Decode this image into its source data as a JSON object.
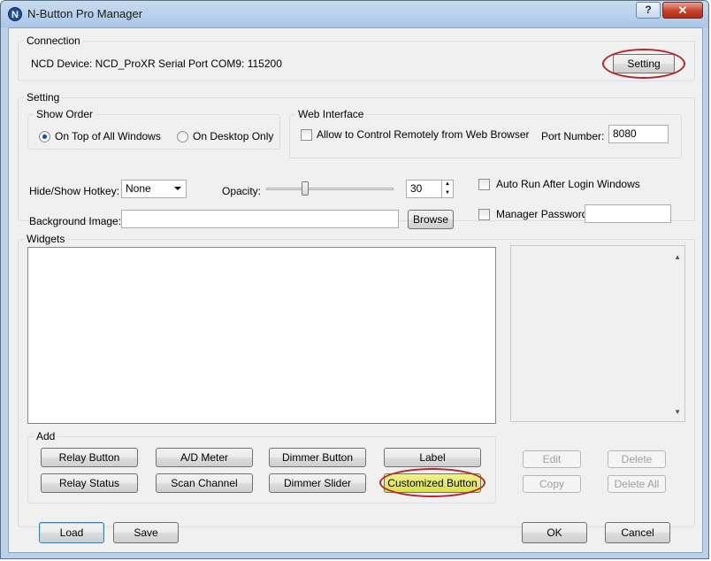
{
  "window": {
    "title": "N-Button Pro Manager",
    "app_icon_letter": "N",
    "help_label": "?",
    "close_label": "✕"
  },
  "connection": {
    "group_label": "Connection",
    "status_text": "NCD Device: NCD_ProXR  Serial Port  COM9: 115200",
    "setting_button": "Setting",
    "setting_highlighted": true
  },
  "setting": {
    "group_label": "Setting",
    "show_order": {
      "label": "Show Order",
      "options": [
        "On Top of All Windows",
        "On Desktop Only"
      ],
      "selected": "On Top of All Windows"
    },
    "web_interface": {
      "label": "Web Interface",
      "allow_remote_label": "Allow to Control Remotely from Web Browser",
      "allow_remote_checked": false,
      "port_label": "Port Number:",
      "port_value": "8080"
    },
    "hotkey": {
      "label": "Hide/Show Hotkey:",
      "value": "None"
    },
    "opacity": {
      "label": "Opacity:",
      "value": "30"
    },
    "auto_run": {
      "label": "Auto Run After Login Windows",
      "checked": false
    },
    "background_image": {
      "label": "Background Image:",
      "value": "",
      "browse_label": "Browse"
    },
    "manager_password": {
      "label": "Manager Password",
      "checked": false,
      "value": ""
    }
  },
  "widgets": {
    "group_label": "Widgets",
    "add": {
      "label": "Add",
      "buttons_row1": [
        "Relay Button",
        "A/D Meter",
        "Dimmer Button",
        "Label"
      ],
      "buttons_row2": [
        "Relay Status",
        "Scan Channel",
        "Dimmer Slider",
        "Customized Button"
      ],
      "highlighted_button": "Customized Button"
    },
    "side_buttons": {
      "edit": "Edit",
      "delete": "Delete",
      "copy": "Copy",
      "delete_all": "Delete All"
    }
  },
  "footer": {
    "load": "Load",
    "save": "Save",
    "ok": "OK",
    "cancel": "Cancel"
  },
  "colors": {
    "highlight_ring": "#b4262b",
    "highlight_fill": "#d9e04a",
    "window_frame": "#b9d1ea"
  }
}
